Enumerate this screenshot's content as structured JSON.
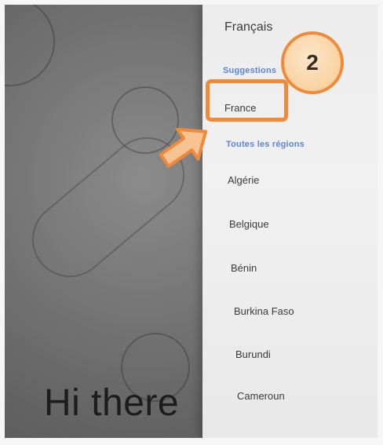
{
  "greeting": "Hi there",
  "panel": {
    "title": "Français",
    "suggestions_label": "Suggestions",
    "all_regions_label": "Toutes les régions",
    "suggested": [
      "France"
    ],
    "regions": [
      "Algérie",
      "Belgique",
      "Bénin",
      "Burkina Faso",
      "Burundi",
      "Cameroun"
    ]
  },
  "annotation": {
    "step_number": "2",
    "accent_color": "#f08a38",
    "badge_fill": "#f9d2a2",
    "icons": [
      "arrow-right-icon",
      "highlight-box"
    ]
  },
  "colors": {
    "section_label": "#5c84d8",
    "text": "#3a3a3a"
  }
}
